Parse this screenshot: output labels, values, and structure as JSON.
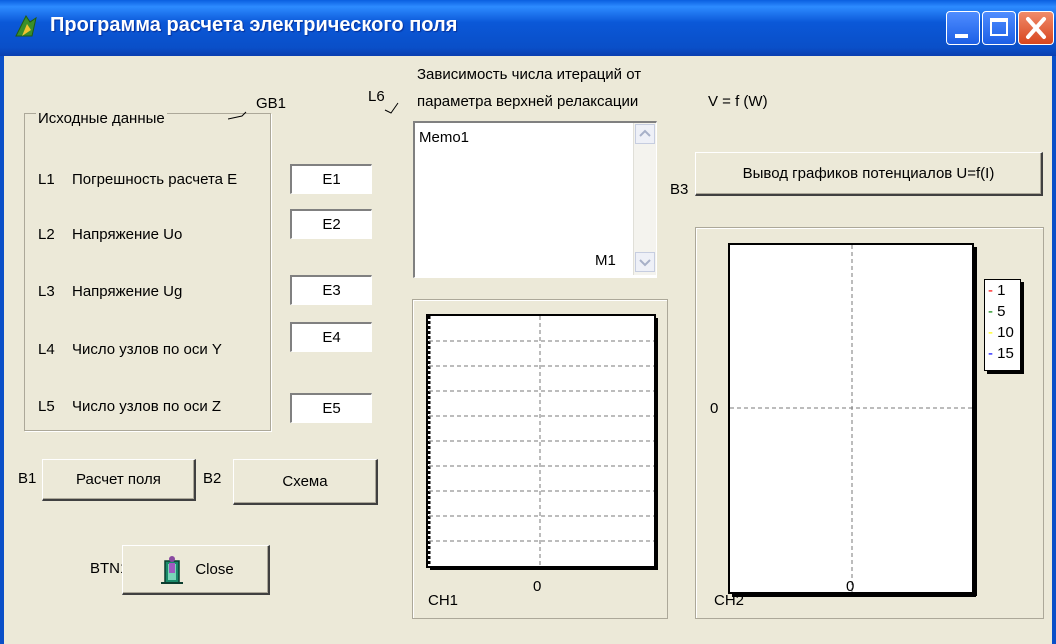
{
  "window": {
    "title": "Программа расчета электрического поля"
  },
  "group": {
    "caption": "Исходные данные",
    "tag": "GB1"
  },
  "fields": [
    {
      "tag": "L1",
      "label": "Погрешность расчета E",
      "value": "E1"
    },
    {
      "tag": "L2",
      "label": "Напряжение Uo",
      "value": "E2"
    },
    {
      "tag": "L3",
      "label": "Напряжение Ug",
      "value": "E3"
    },
    {
      "tag": "L4",
      "label": "Число узлов по оси Y",
      "value": "E4"
    },
    {
      "tag": "L5",
      "label": "Число узлов по оси Z",
      "value": "E5"
    }
  ],
  "buttons": {
    "b1_tag": "B1",
    "b1_label": "Расчет поля",
    "b2_tag": "B2",
    "b2_label": "Схема",
    "b3_tag": "B3",
    "b3_label": "Вывод графиков потенциалов U=f(I)",
    "close_tag": "BTN1",
    "close_label": "Close"
  },
  "l6": {
    "tag": "L6",
    "line1": "Зависимость числа итераций от",
    "line2": "параметра верхней релаксации",
    "formula": "V = f (W)"
  },
  "memo": {
    "text": "Memo1",
    "tag": "M1"
  },
  "chart_data": [
    {
      "type": "line",
      "name": "CH1",
      "xtick": "0",
      "series": []
    },
    {
      "type": "line",
      "name": "CH2",
      "xtick": "0",
      "ytick": "0",
      "legend_position": "right",
      "series": [
        {
          "name": "1",
          "color": "#ff0000",
          "values": []
        },
        {
          "name": "5",
          "color": "#008000",
          "values": []
        },
        {
          "name": "10",
          "color": "#ffff00",
          "values": []
        },
        {
          "name": "15",
          "color": "#0000ff",
          "values": []
        }
      ]
    }
  ]
}
